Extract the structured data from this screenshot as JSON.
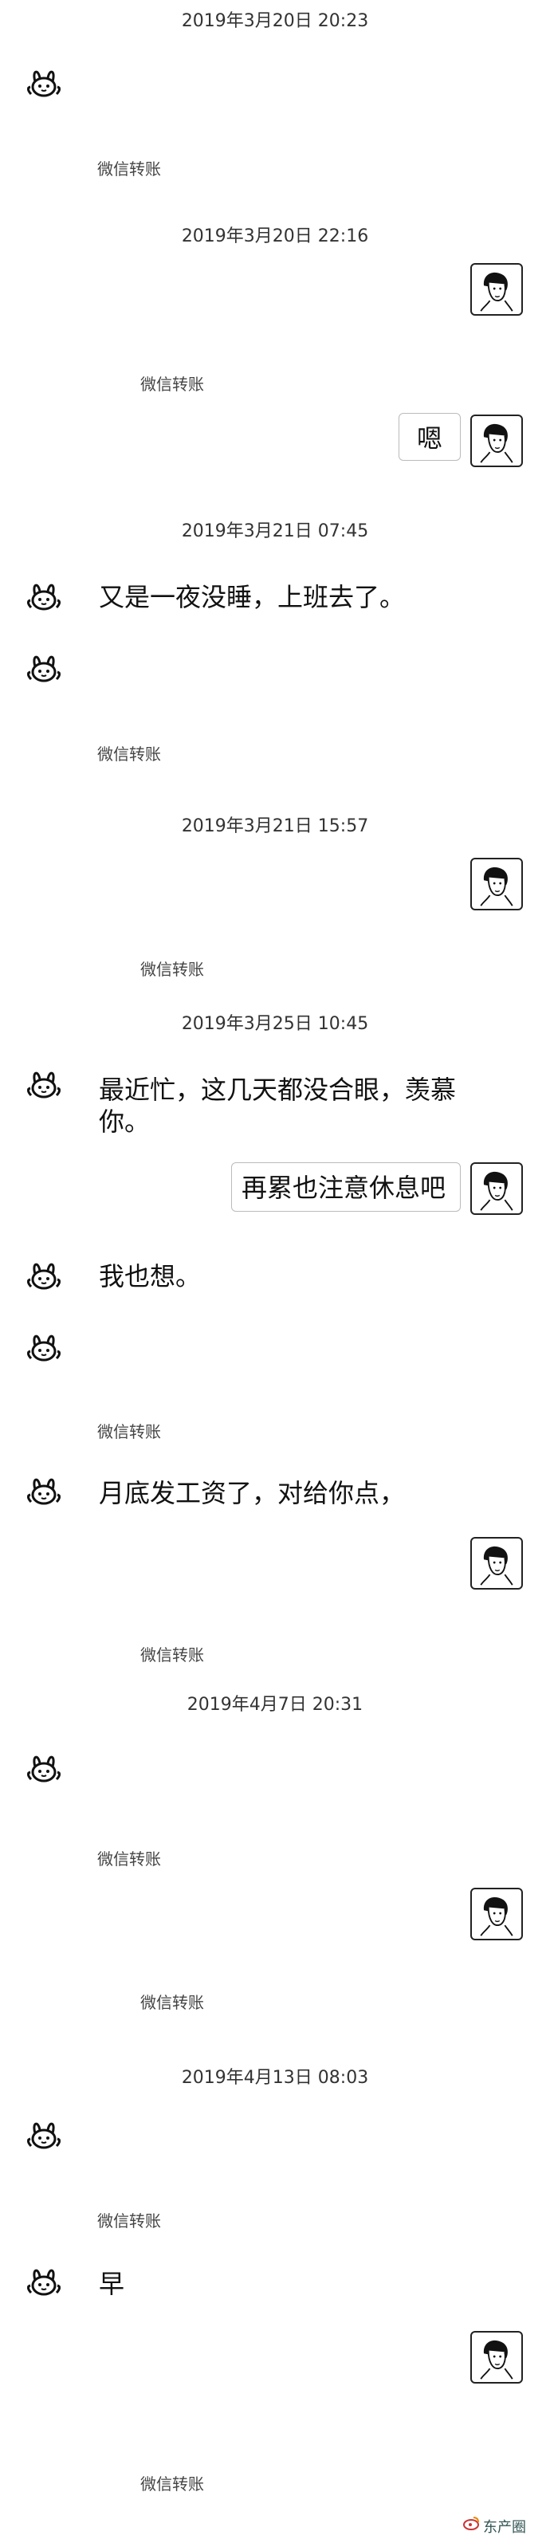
{
  "timestamps": {
    "t1": "2019年3月20日 20:23",
    "t2": "2019年3月20日 22:16",
    "t3": "2019年3月21日 07:45",
    "t4": "2019年3月21日 15:57",
    "t5": "2019年3月25日 10:45",
    "t6": "2019年4月7日 20:31",
    "t7": "2019年4月13日 08:03"
  },
  "transfer_label": "微信转账",
  "messages": {
    "m1": "嗯",
    "m2": "又是一夜没睡，上班去了。",
    "m3_line1": "最近忙，这几天都没合眼，羡慕",
    "m3_line2": "你。",
    "m4": "再累也注意休息吧",
    "m5": "我也想。",
    "m6": "月底发工资了，对给你点，",
    "m7": "早"
  },
  "watermark": "东产圈",
  "icons": {
    "left_avatar": "rabbit-avatar-icon",
    "right_avatar": "portrait-avatar-icon"
  }
}
